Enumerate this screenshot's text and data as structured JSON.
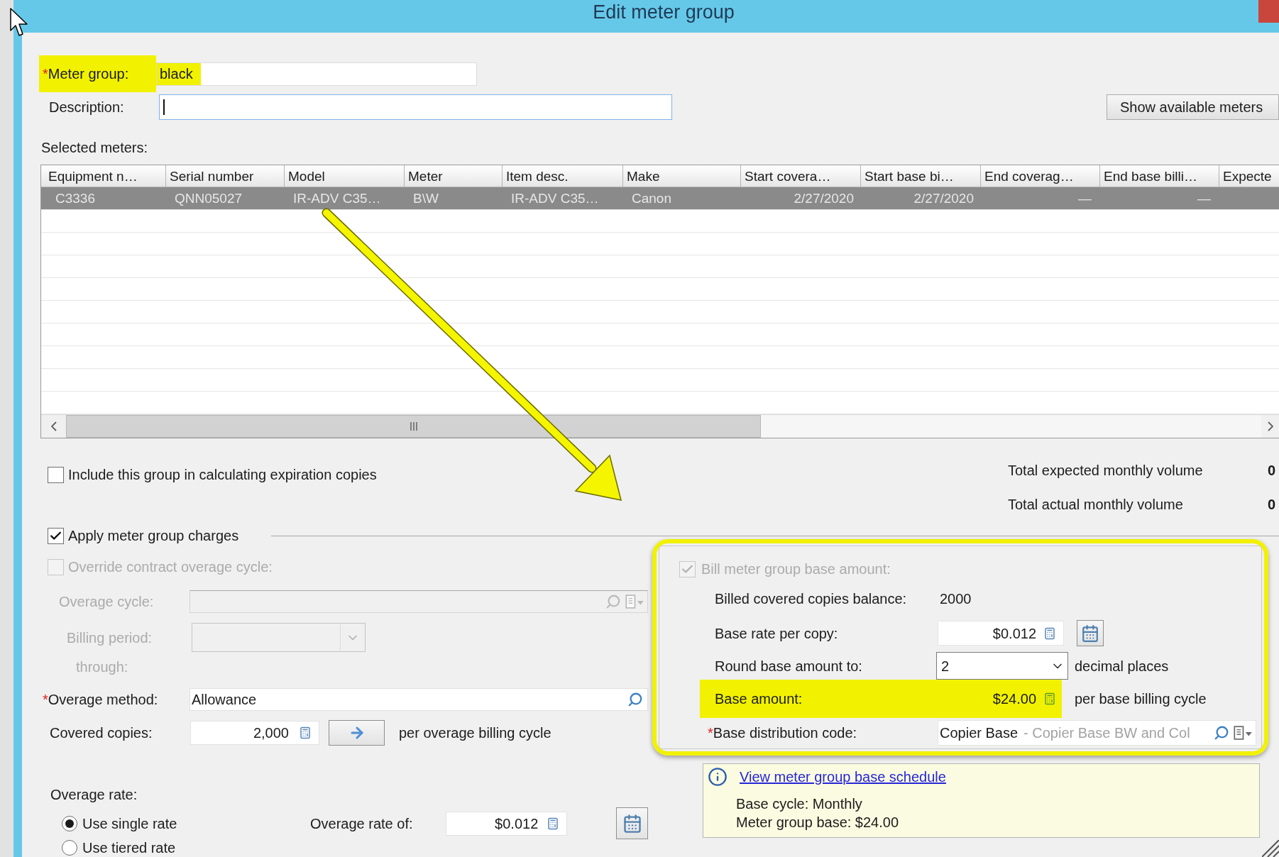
{
  "window": {
    "title": "Edit meter group"
  },
  "meter_group": {
    "marker": "*",
    "label": "Meter group:",
    "value": "black",
    "highlighted": true
  },
  "description": {
    "label": "Description:",
    "focused": true
  },
  "show_meters_button": {
    "label": "Show available meters"
  },
  "selected_meters": {
    "label": "Selected meters:",
    "columns": [
      "Equipment n…",
      "Serial number",
      "Model",
      "Meter",
      "Item desc.",
      "Make",
      "Start covera…",
      "Start base bi…",
      "End coverag…",
      "End base billi…",
      "Expecte"
    ],
    "rows": [
      {
        "selected": true,
        "cells": [
          "C3336",
          "QNN05027",
          "IR-ADV C35…",
          "B\\W",
          "IR-ADV C35…",
          "Canon",
          "2/27/2020",
          "2/27/2020",
          "—",
          "—"
        ]
      }
    ]
  },
  "include_expiration": {
    "label": "Include this group in calculating expiration copies",
    "checked": false
  },
  "totals": [
    {
      "label": "Total expected monthly volume",
      "value": "0"
    },
    {
      "label": "Total actual monthly volume",
      "value": "0"
    }
  ],
  "apply_charges": {
    "label": "Apply meter group charges",
    "checked": true
  },
  "override_cycle": {
    "label": "Override contract overage cycle:",
    "checked": false,
    "disabled": true
  },
  "overage_cycle": {
    "label": "Overage cycle:",
    "disabled": true
  },
  "billing_period": {
    "label": "Billing period:",
    "disabled": true
  },
  "through": {
    "label": "through:",
    "disabled": true
  },
  "overage_method": {
    "marker": "*",
    "label": "Overage method:",
    "value": "Allowance"
  },
  "covered_copies": {
    "label": "Covered copies:",
    "value": "2,000",
    "suffix": "per overage billing cycle"
  },
  "overage_rate": {
    "label": "Overage rate:",
    "options": [
      {
        "label": "Use single rate",
        "selected": true
      },
      {
        "label": "Use tiered rate",
        "selected": false
      }
    ],
    "rate_label": "Overage rate of:",
    "rate_value": "$0.012"
  },
  "base_panel": {
    "bill_base": {
      "label": "Bill meter group base amount:",
      "checked": true,
      "disabled": true
    },
    "billed_balance": {
      "label": "Billed covered copies balance:",
      "value": "2000"
    },
    "base_rate": {
      "label": "Base rate per copy:",
      "value": "$0.012"
    },
    "round_to": {
      "label": "Round base amount to:",
      "value": "2",
      "suffix": "decimal places"
    },
    "base_amount": {
      "label": "Base amount:",
      "value": "$24.00",
      "suffix": "per base billing cycle",
      "highlighted": true
    },
    "distribution_code": {
      "marker": "*",
      "label": "Base distribution code:",
      "value": "Copier Base",
      "detail": "- Copier Base BW and Col"
    }
  },
  "base_info": {
    "link": "View meter group base schedule",
    "lines": [
      "Base cycle: Monthly",
      "Meter group base: $24.00"
    ]
  }
}
